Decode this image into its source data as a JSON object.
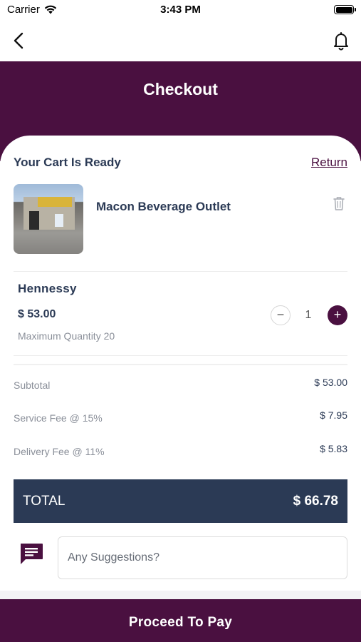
{
  "status_bar": {
    "carrier": "Carrier",
    "time": "3:43 PM"
  },
  "nav": {
    "back_icon": "chevron-left-icon",
    "bell_icon": "bell-icon"
  },
  "header": {
    "title": "Checkout"
  },
  "cart": {
    "heading": "Your Cart Is Ready",
    "return_label": "Return",
    "store_name": "Macon Beverage Outlet",
    "item": {
      "name": "Hennessy",
      "price": "$ 53.00",
      "max_quantity": "Maximum Quantity 20",
      "quantity": "1",
      "minus_label": "−",
      "plus_label": "+"
    }
  },
  "summary": {
    "subtotal_label": "Subtotal",
    "subtotal_value": "$ 53.00",
    "service_fee_label": "Service Fee @ 15%",
    "service_fee_value": "$ 7.95",
    "delivery_fee_label": "Delivery Fee @ 11%",
    "delivery_fee_value": "$ 5.83",
    "total_label": "TOTAL",
    "total_value": "$ 66.78"
  },
  "suggestions": {
    "placeholder": "Any Suggestions?",
    "value": ""
  },
  "footer": {
    "pay_label": "Proceed To Pay"
  },
  "colors": {
    "brand": "#4a1040",
    "navy": "#2b3a55"
  }
}
